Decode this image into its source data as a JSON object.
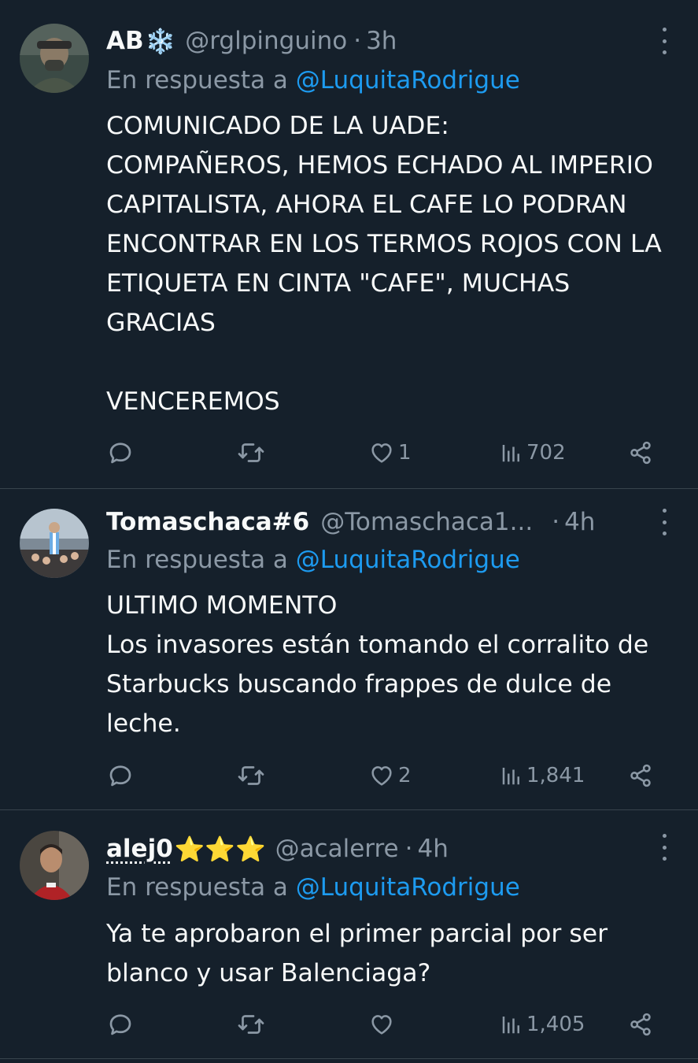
{
  "tweets": [
    {
      "name": "AB",
      "badge": "❄️",
      "handle": "@rglpinguino",
      "dot": "·",
      "time": "3h",
      "reply_prefix": "En respuesta a",
      "reply_to": "@LuquitaRodrigue",
      "body": "COMUNICADO DE LA UADE:\nCOMPAÑEROS, HEMOS ECHADO AL IMPERIO CAPITALISTA, AHORA EL CAFE LO PODRAN ENCONTRAR EN LOS TERMOS ROJOS CON LA ETIQUETA EN CINTA \"CAFE\", MUCHAS GRACIAS\n\nVENCEREMOS",
      "likes": "1",
      "views": "702"
    },
    {
      "name": "Tomaschaca#6",
      "badge": "",
      "handle": "@Tomaschaca1...",
      "dot": "·",
      "time": "4h",
      "reply_prefix": "En respuesta a",
      "reply_to": "@LuquitaRodrigue",
      "body": "ULTIMO MOMENTO\nLos invasores están tomando el corralito de Starbucks buscando frappes de dulce de leche.",
      "likes": "2",
      "views": "1,841"
    },
    {
      "name": "alej0",
      "badge": "⭐⭐⭐",
      "handle": "@acalerre",
      "dot": "·",
      "time": "4h",
      "reply_prefix": "En respuesta a",
      "reply_to": "@LuquitaRodrigue",
      "body": "Ya te aprobaron el primer parcial por ser blanco y usar Balenciaga?",
      "likes": "",
      "views": "1,405"
    }
  ],
  "icons": {
    "reply": "reply-icon",
    "retweet": "retweet-icon",
    "like": "heart-icon",
    "views": "views-icon",
    "share": "share-icon",
    "more": "more-icon"
  },
  "colors": {
    "background": "#15202b",
    "text": "#f7f9f9",
    "secondary": "#8b98a5",
    "link": "#1d9bf0",
    "divider": "#38444d"
  }
}
